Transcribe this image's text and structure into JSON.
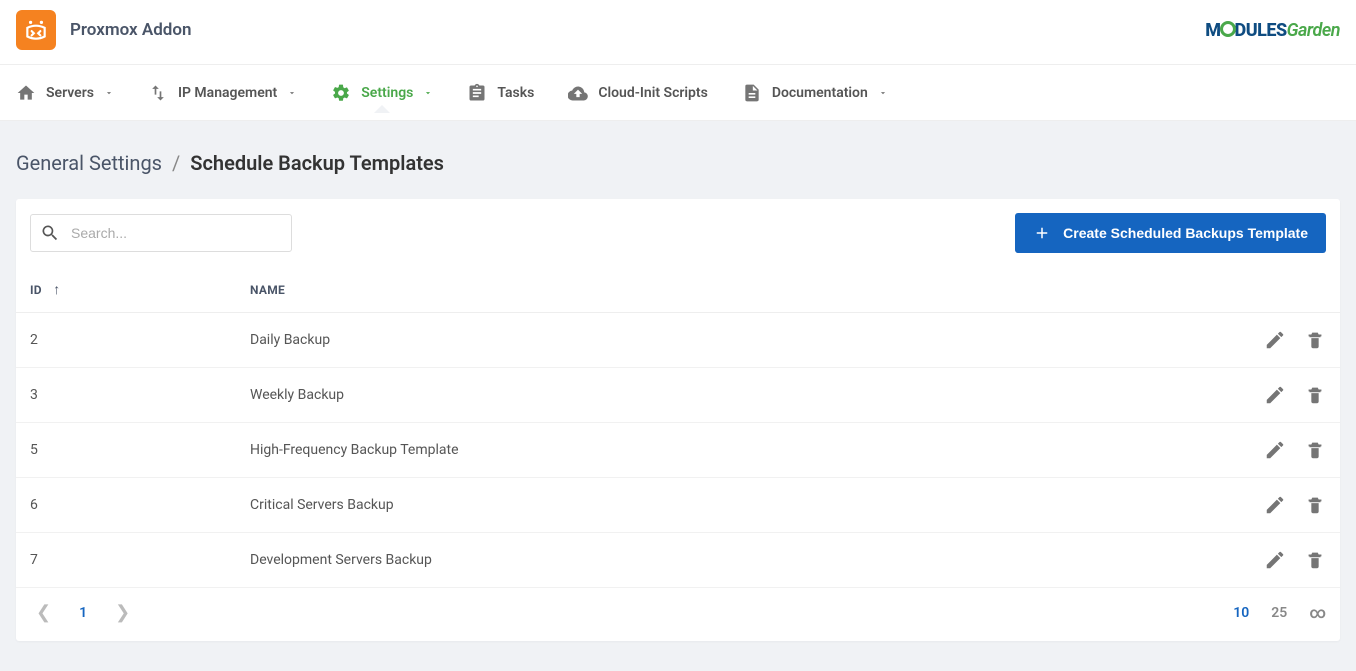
{
  "header": {
    "app_title": "Proxmox Addon",
    "logo_text_1": "M",
    "logo_text_2": "DULES",
    "logo_text_3": "Garden"
  },
  "nav": {
    "servers": "Servers",
    "ip_management": "IP Management",
    "settings": "Settings",
    "tasks": "Tasks",
    "cloud_init": "Cloud-Init Scripts",
    "documentation": "Documentation"
  },
  "breadcrumb": {
    "parent": "General Settings",
    "current": "Schedule Backup Templates"
  },
  "toolbar": {
    "search_placeholder": "Search...",
    "create_button": "Create Scheduled Backups Template"
  },
  "table": {
    "headers": {
      "id": "ID",
      "name": "NAME"
    },
    "rows": [
      {
        "id": "2",
        "name": "Daily Backup"
      },
      {
        "id": "3",
        "name": "Weekly Backup"
      },
      {
        "id": "5",
        "name": "High-Frequency Backup Template"
      },
      {
        "id": "6",
        "name": "Critical Servers Backup"
      },
      {
        "id": "7",
        "name": "Development Servers Backup"
      }
    ]
  },
  "pagination": {
    "current_page": "1",
    "sizes": [
      "10",
      "25",
      "∞"
    ],
    "active_size": "10"
  }
}
